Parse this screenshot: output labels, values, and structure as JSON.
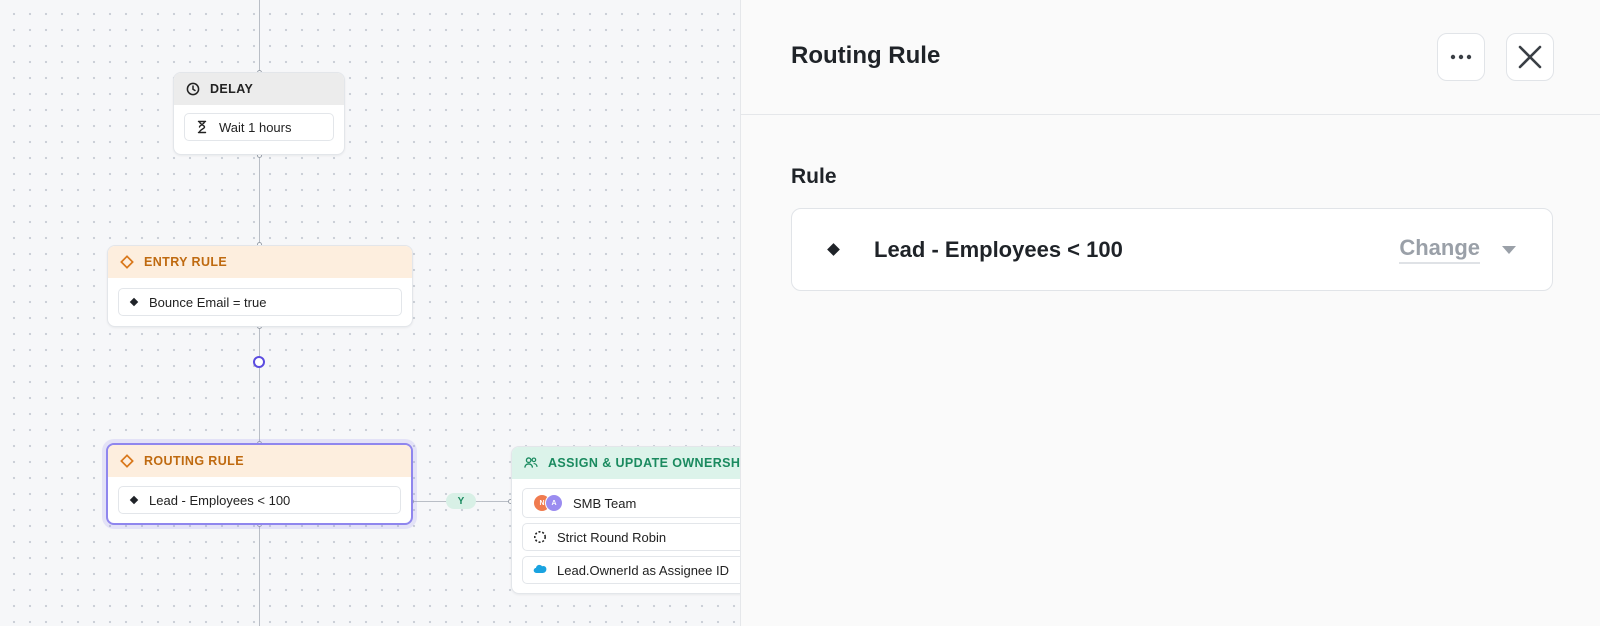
{
  "canvas": {
    "delay_node": {
      "title": "DELAY",
      "items": [
        "Wait 1 hours"
      ]
    },
    "entry_rule_node": {
      "title": "ENTRY RULE",
      "items": [
        "Bounce Email = true"
      ]
    },
    "routing_rule_node": {
      "title": "ROUTING RULE",
      "items": [
        "Lead - Employees < 100"
      ]
    },
    "branch_label": "Y",
    "assign_node": {
      "title": "ASSIGN & UPDATE OWNERSHIP",
      "items": [
        "SMB Team",
        "Strict Round Robin",
        "Lead.OwnerId as Assignee ID"
      ],
      "avatars": [
        {
          "initial": "N",
          "color": "#f07b4f"
        },
        {
          "initial": "A",
          "color": "#9b8cf0"
        }
      ]
    }
  },
  "panel": {
    "title": "Routing Rule",
    "section_label": "Rule",
    "rule_value": "Lead - Employees < 100",
    "change_label": "Change"
  }
}
